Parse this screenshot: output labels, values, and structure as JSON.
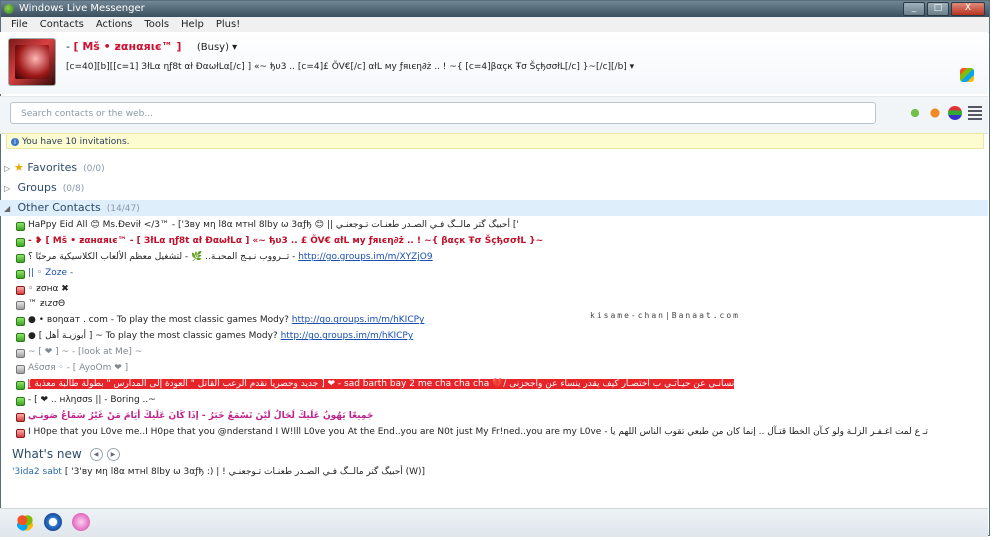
{
  "window": {
    "title": "Windows Live Messenger",
    "buttons": [
      "_",
      "□",
      "X"
    ]
  },
  "menu": [
    "File",
    "Contacts",
    "Actions",
    "Tools",
    "Help",
    "Plus!"
  ],
  "profile": {
    "name_prefix": "-",
    "name_main": "[ Mš • ƶαнαяιє™ ]",
    "status": "(Busy) ▾",
    "message": "[c=40][b][[c=1] ЗłLα ηƒ8t αł ÐαωłLα[/c] ] «~ ђυ3 .. [c=4]£ ÕV€[/c] αłL мy ƒяιєη∂ż .. ! ~{ [c=4]βαçк Ŧσ ŠçђσσłL[/c] }~[/c][/b]  ▾"
  },
  "search": {
    "placeholder": "Search contacts or the web..."
  },
  "invite": "You have 10 invitations.",
  "groups": [
    {
      "name": "Favorites",
      "count": "(0/0)"
    },
    {
      "name": "Groups",
      "count": "(0/8)"
    },
    {
      "name": "Other Contacts",
      "count": "(14/47)"
    }
  ],
  "contacts": [
    {
      "status": "on",
      "text": "HaPpy Eid All 😊 Ms.Ðevił </3™  - ['3вy мη l8α мтнl 8lby ω 3αƒђ 😊 || أحبيگ گتر مالــگ فـي الصـدر طعنـات تـوجعنـي ['"
    },
    {
      "status": "on",
      "text": "-   ❥ [ Mš • ƶαнαяιє™  - [ ЗłLα ηƒ8t αł ÐαωłLα ] «~ ђυ3 .. £ ÕV€ αłL мy ƒяιєη∂ż .. ! ~{ βαçк Ŧσ ŠçђσσłL }~"
    },
    {
      "status": "on",
      "text": "تــرووب نـيـج المحبـة.. 🌿 -  لتشغيل معظم الألعاب الكلاسيكية مرحبًا ؟ -",
      "link": "http://go.groups.im/m/XYZjO9"
    },
    {
      "status": "on",
      "text": "|| ◦ Zoze  -"
    },
    {
      "status": "away",
      "text": "◦                          ƶσнα ✖"
    },
    {
      "status": "off",
      "text": "                           ™ ƶιzσΘ"
    },
    {
      "status": "on",
      "text": "● • воηαат . com  - To play the most classic games Mody?",
      "link": "http://go.groups.im/m/hKICPy"
    },
    {
      "status": "on",
      "text": "● [ أبوزيـة أهل ] ~ To play the most classic games Mody?",
      "link": "http://go.groups.im/m/hKICPy"
    },
    {
      "status": "off",
      "text": "~ [ ❤ ] ~  - [look at Me] ~"
    },
    {
      "status": "off",
      "text": "                  Aŝσσя ◦ - [ AyoOm ❤ ]"
    },
    {
      "status": "on",
      "text": "[ جديد وحصرياً نقدم الرعب القاتل \" العودة إلى المدارس \" بطولة طالبة معذبة ]  ❤  - sad barth bay 2 me cha cha cha  💔/ نسانـي عن حيـآتـي ب اختصـآر كيف يقدر ينسآء عن واجحزنى"
    },
    {
      "status": "on",
      "text": "- [ ❤ .. нλησσs ||  - Boring ..~"
    },
    {
      "status": "away",
      "text": "جَمِيعًا يَهُونُ عَلَيكَ لَحَالُ لَيْنَ تَسْمَعُ خَبَرُ  - إذَا كَانَ عَلَيكَ أيَامَ مَنْ غَيْرُ سَمَاعُ صَوتـي"
    },
    {
      "status": "away",
      "text": "I H0pe that you L0ve me..I H0pe that you @nderstand I W!lll L0ve you At the End..you are N0t just My Fr!ned..you are my L0ve  -  تـ ع لمت اغـفـر الزلـة ولو كـآن الخطا قتـآل .. إنما كان من طبعي تقوب الناس اللهم يا"
    }
  ],
  "watermark": "kisame-chan|Banaat.com",
  "whats_new": {
    "title": "What's new",
    "controls": [
      "◀",
      "▶"
    ]
  },
  "news": {
    "who": "'3ida2 sabt",
    "text": " [ '3'вy мη l8α мтнl 8lby ω 3αƒђ :) | ! أحبيگ گتر مالــگ فـي الصـدر طعنـات تـوجعنـي (W)]"
  },
  "icons": {
    "title": "windows-live-logo-icon",
    "add": "add-contact-icon"
  }
}
